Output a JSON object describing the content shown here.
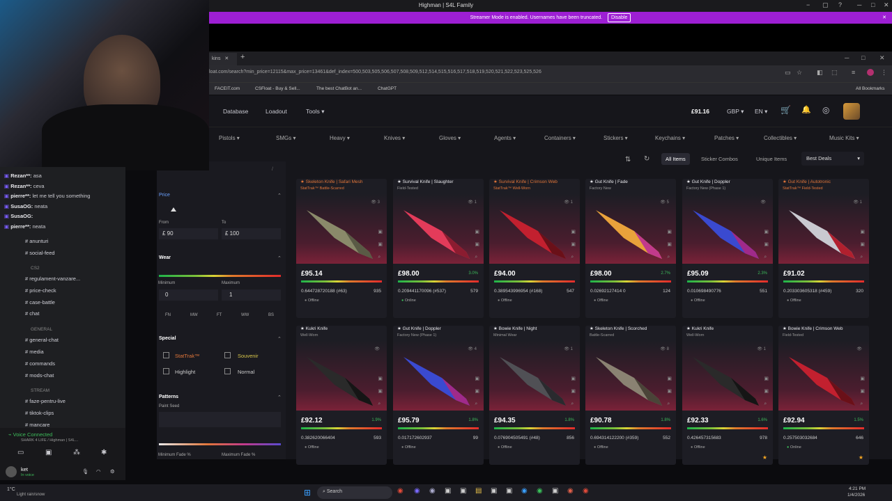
{
  "window": {
    "title": "Highman | S4L Family"
  },
  "streamer_bar": {
    "text": "Streamer Mode is enabled. Usernames have been truncated.",
    "button": "Disable"
  },
  "browser": {
    "url": "loat.com/search?min_price=12115&max_price=13461&def_index=500,503,505,506,507,508,509,512,514,515,516,517,518,519,520,521,522,523,525,526",
    "bookmarks": [
      "FACEIT.com",
      "CSFloat - Buy & Sell...",
      "The best ChatBot an...",
      "ChatGPT"
    ],
    "all_bookmarks": "All Bookmarks"
  },
  "site": {
    "nav": [
      "Database",
      "Loadout",
      "Tools"
    ],
    "balance": "£91.16",
    "currency": "GBP",
    "language": "EN",
    "categories": [
      "Pistols",
      "SMGs",
      "Heavy",
      "Knives",
      "Gloves",
      "Agents",
      "Containers",
      "Stickers",
      "Keychains",
      "Patches",
      "Collectibles",
      "Music Kits"
    ],
    "filter_tabs": [
      "All Items",
      "Sticker Combos",
      "Unique Items"
    ],
    "sort": "Best Deals"
  },
  "sidebar": {
    "price_label": "Price",
    "from_label": "From",
    "to_label": "To",
    "from_value": "£ 90",
    "to_value": "£ 100",
    "wear_label": "Wear",
    "min_label": "Minimum",
    "max_label": "Maximum",
    "min_value": "0",
    "max_value": "1",
    "wear_grades": [
      "FN",
      "MW",
      "FT",
      "WW",
      "BS"
    ],
    "special_label": "Special",
    "special_options": [
      "StatTrak™",
      "Souvenir",
      "Highlight",
      "Normal"
    ],
    "patterns_label": "Patterns",
    "paint_seed_label": "Paint Seed",
    "min_fade_label": "Minimum Fade %",
    "max_fade_label": "Maximum Fade %"
  },
  "cards": [
    {
      "name": "★ Skeleton Knife | Safari Mesh",
      "cond": "StatTrak™ Battle-Scarred",
      "price": "£95.14",
      "disc": "",
      "float": "0.644728720188 (#63)",
      "count": "935",
      "status": "Offline",
      "views": "3",
      "colors": [
        "#8a8a6a",
        "#5a5a45"
      ],
      "star": false
    },
    {
      "name": "★ Survival Knife | Slaughter",
      "cond": "Field-Tested",
      "price": "£98.00",
      "disc": "3.0%",
      "float": "0.209441170096 (#537)",
      "count": "579",
      "status": "Online",
      "views": "1",
      "colors": [
        "#e33b5a",
        "#8b1c30"
      ],
      "star": false
    },
    {
      "name": "★ Survival Knife | Crimson Web",
      "cond": "StatTrak™ Well-Worn",
      "price": "£94.00",
      "disc": "",
      "float": "0.389543996954 (#168)",
      "count": "547",
      "status": "Offline",
      "views": "1",
      "colors": [
        "#c2202f",
        "#6a1018"
      ],
      "star": false
    },
    {
      "name": "★ Gut Knife | Fade",
      "cond": "Factory New",
      "price": "£98.00",
      "disc": "2.7%",
      "float": "0.02692127414 0",
      "count": "124",
      "status": "Offline",
      "views": "5",
      "colors": [
        "#e9a23b",
        "#c23a8c"
      ],
      "star": false
    },
    {
      "name": "★ Gut Knife | Doppler",
      "cond": "Factory New (Phase 1)",
      "price": "£95.09",
      "disc": "2.3%",
      "float": "0.010698490776",
      "count": "551",
      "status": "Offline",
      "views": "",
      "colors": [
        "#3a4ad0",
        "#a02a8a"
      ],
      "star": false
    },
    {
      "name": "★ Gut Knife | Autotronic",
      "cond": "StatTrak™ Field-Tested",
      "price": "£91.02",
      "disc": "",
      "float": "0.203303605318 (#459)",
      "count": "320",
      "status": "Offline",
      "views": "1",
      "colors": [
        "#c9c9d0",
        "#b0202e"
      ],
      "star": false
    },
    {
      "name": "★ Kukri Knife",
      "cond": "Well-Worn",
      "price": "£92.12",
      "disc": "1.9%",
      "float": "0.382620066404",
      "count": "593",
      "status": "Offline",
      "views": "",
      "colors": [
        "#2a2a2a",
        "#151515"
      ],
      "star": false
    },
    {
      "name": "★ Gut Knife | Doppler",
      "cond": "Factory New (Phase 1)",
      "price": "£95.79",
      "disc": "1.8%",
      "float": "0.017172602937",
      "count": "99",
      "status": "Offline",
      "views": "4",
      "colors": [
        "#3a4ad0",
        "#a02a8a"
      ],
      "star": false
    },
    {
      "name": "★ Bowie Knife | Night",
      "cond": "Minimal Wear",
      "price": "£94.35",
      "disc": "1.8%",
      "float": "0.076904505491 (#48)",
      "count": "856",
      "status": "Offline",
      "views": "1",
      "colors": [
        "#505055",
        "#2a2a2e"
      ],
      "star": false
    },
    {
      "name": "★ Skeleton Knife | Scorched",
      "cond": "Battle-Scarred",
      "price": "£90.78",
      "disc": "1.8%",
      "float": "0.694314122200 (#359)",
      "count": "552",
      "status": "Offline",
      "views": "8",
      "colors": [
        "#8a8272",
        "#4a4438"
      ],
      "star": false
    },
    {
      "name": "★ Kukri Knife",
      "cond": "Well-Worn",
      "price": "£92.33",
      "disc": "1.6%",
      "float": "0.426457315683",
      "count": "978",
      "status": "Offline",
      "views": "1",
      "colors": [
        "#2a2a2a",
        "#151515"
      ],
      "star": true
    },
    {
      "name": "★ Bowie Knife | Crimson Web",
      "cond": "Field-Tested",
      "price": "£92.94",
      "disc": "1.5%",
      "float": "0.257503032684",
      "count": "646",
      "status": "Online",
      "views": "",
      "colors": [
        "#c2202f",
        "#6a1018"
      ],
      "star": true
    }
  ],
  "discord": {
    "chat": [
      {
        "user": "Rezan**:",
        "msg": "asa"
      },
      {
        "user": "Rezan**:",
        "msg": "ceva"
      },
      {
        "user": "pierre**:",
        "msg": "let me tell you something"
      },
      {
        "user": "SusaOG:",
        "msg": "neata"
      },
      {
        "user": "SusaOG:",
        "msg": ""
      },
      {
        "user": "pierre**:",
        "msg": "neata"
      }
    ],
    "channels": [
      "anunturi",
      "social-feed",
      "CS2",
      "regulament-vanzare...",
      "price-check",
      "case-battle",
      "chat",
      "GENERAL",
      "general-chat",
      "media",
      "commands",
      "mods-chat",
      "STREAM",
      "faze-pentru-live",
      "tiktok-clips",
      "mancare"
    ],
    "voice": "Voice Connected",
    "voice_sub": "SHARK 4 LIFE / Highman | S4L...",
    "user": "ket",
    "user_status": "In voice"
  },
  "taskbar": {
    "weather": "1°C",
    "weather_sub": "Light rain/snow",
    "search": "Search",
    "time": "4:21 PM",
    "date": "1/4/2026"
  }
}
